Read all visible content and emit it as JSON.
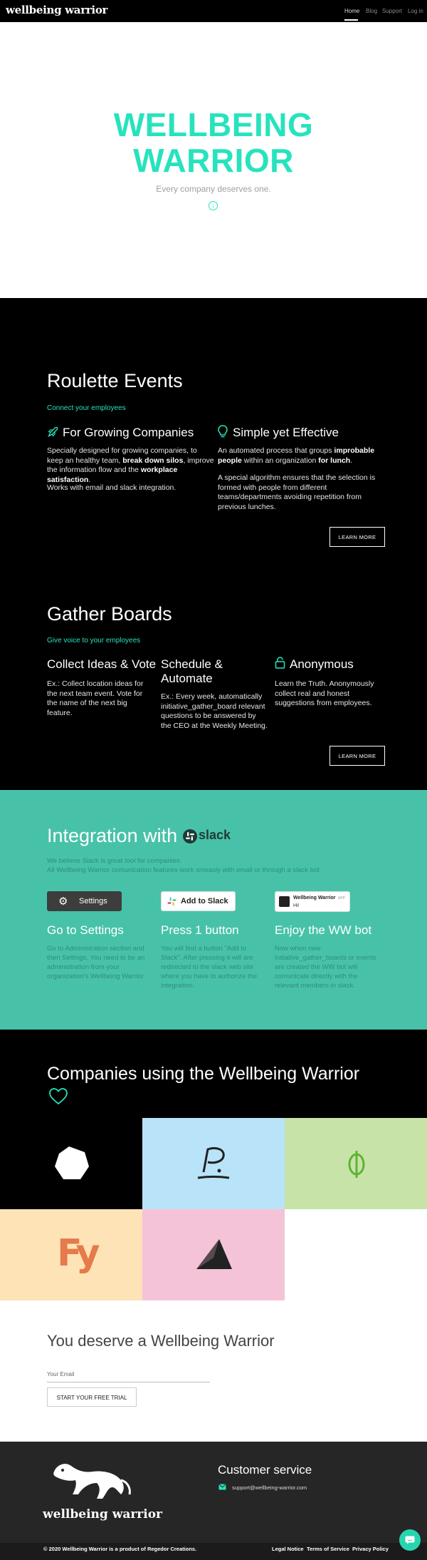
{
  "header": {
    "brand": "wellbeing warrior",
    "nav": [
      "Home",
      "Blog",
      "Support",
      "Log in"
    ]
  },
  "hero": {
    "title_line1": "WELLBEING",
    "title_line2": "WARRIOR",
    "subtitle": "Every company deserves one."
  },
  "roulette": {
    "title": "Roulette Events",
    "tagline": "Connect your employees",
    "col1": {
      "heading": "For Growing Companies",
      "p1_a": "Specially designed for growing companies, to keep an healthy team, ",
      "p1_b": "break down silos",
      "p1_c": ", improve the information flow and the ",
      "p1_d": "workplace satisfaction",
      "p1_e": ".",
      "p2": "Works with email and slack integration."
    },
    "col2": {
      "heading": "Simple yet Effective",
      "p1_a": "An automated process that groups ",
      "p1_b": "improbable people",
      "p1_c": " within an organization ",
      "p1_d": "for lunch",
      "p1_e": ".",
      "p2": "A special algorithm ensures that the selection is formed with people from different teams/departments avoiding repetition from previous lunches."
    },
    "button": "LEARN MORE"
  },
  "gather": {
    "title": "Gather Boards",
    "tagline": "Give voice to your employees",
    "col1": {
      "heading": "Collect Ideas & Vote",
      "text": "Ex.: Collect location ideas for the next team event. Vote for the name of the next big feature."
    },
    "col2": {
      "heading": "Schedule & Automate",
      "text": "Ex.: Every week, automatically initiative_gather_board relevant questions to be answered by the CEO at the Weekly Meeting."
    },
    "col3": {
      "heading": "Anonymous",
      "text": "Learn the Truth. Anonymously collect real and honest suggestions from employees."
    },
    "button": "LEARN MORE"
  },
  "integration": {
    "title": "Integration with",
    "slack_word": "slack",
    "line1": "We believe Slack is great tool for companies.",
    "line2": "All Wellbeing Warrior comunication features work smeasly with email or through a slack bot.",
    "mock_settings": "Settings",
    "mock_add": "Add to Slack",
    "mock_bot_name": "Wellbeing Warrior",
    "mock_bot_badge": "APP",
    "mock_bot_msg": "Hi!",
    "steps": [
      {
        "heading": "Go to Settings",
        "text": "Go to Administration section and then Settings. You need to be an administration from your organization's Wellbeing Warrior."
      },
      {
        "heading": "Press 1 button",
        "text": "You will find a button \"Add to Slack\". After pressing it will are redirected to the slack web site where you have to authorize the integration."
      },
      {
        "heading": "Enjoy the WW bot",
        "text": "Now when new initiative_gather_boards or events are created the WW bot will comunicate directly with the relevant members in slack."
      }
    ]
  },
  "companies": {
    "title": "Companies using the Wellbeing Warrior",
    "tile_colors": [
      "#000000",
      "#b9e3f8",
      "#c8e3a8",
      "#fde3b5",
      "#f5c3d8",
      "#ffffff"
    ]
  },
  "cta": {
    "title": "You deserve a Wellbeing Warrior",
    "email_label": "Your Email",
    "button": "START YOUR FREE TRIAL"
  },
  "footer": {
    "brand": "wellbeing warrior",
    "cs_title": "Customer service",
    "email": "support@wellbeing-warrior.com",
    "copyright": "© 2020 Wellbeing Warrior is a product of Regedor Creations.",
    "links": [
      "Legal Notice",
      "Terms of Service",
      "Privacy Policy"
    ]
  },
  "colors": {
    "accent": "#27e3bd",
    "teal_bg": "#47c2a9",
    "dark": "#000000",
    "footer": "#262626"
  }
}
